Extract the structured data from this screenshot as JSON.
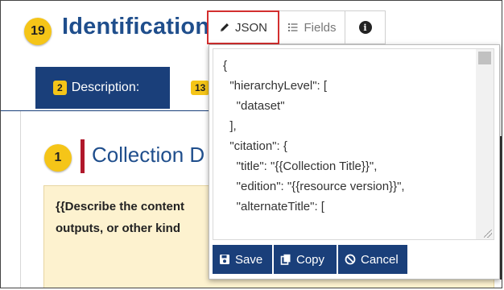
{
  "header": {
    "badge_count": "19",
    "title": "Identification"
  },
  "toolbar": {
    "json_label": "JSON",
    "fields_label": "Fields",
    "info_icon": "info-circle-icon"
  },
  "tabs": [
    {
      "count": "2",
      "label": "Description:"
    },
    {
      "count": "13",
      "label": ""
    }
  ],
  "section": {
    "badge_count": "1",
    "title": "Collection D",
    "description_line1": "{{Describe the content",
    "description_line2": "outputs, or other kind"
  },
  "json_editor": {
    "lines": [
      "{",
      "  \"hierarchyLevel\": [",
      "    \"dataset\"",
      "  ],",
      "  \"citation\": {",
      "    \"title\": \"{{Collection Title}}\",",
      "    \"edition\": \"{{resource version}}\",",
      "    \"alternateTitle\": ["
    ]
  },
  "actions": {
    "save_label": "Save",
    "copy_label": "Copy",
    "cancel_label": "Cancel"
  },
  "colors": {
    "primary": "#1a3f7a",
    "badge": "#f5c518",
    "accent_red": "#b0182b",
    "highlight_border": "#d32f2f",
    "description_bg": "#fdf2cf"
  }
}
